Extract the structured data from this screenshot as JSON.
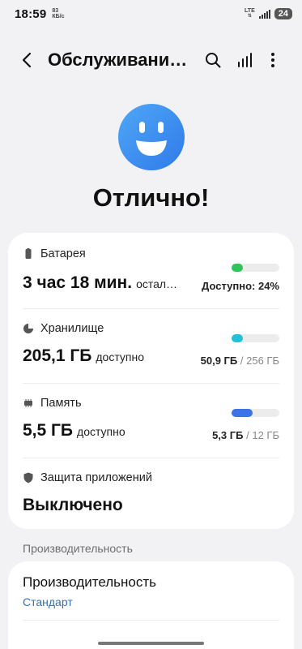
{
  "status_bar": {
    "time": "18:59",
    "net_speed_value": "83",
    "net_speed_unit": "КБ/с",
    "network_type": "LTE",
    "battery_level": "24"
  },
  "app_bar": {
    "title": "Обслуживани…"
  },
  "hero": {
    "status": "Отлично!",
    "icon": "smiley-face-icon",
    "accent_color": "#3b8df2"
  },
  "items": {
    "battery": {
      "label": "Батарея",
      "value": "3 час 18 мин.",
      "suffix": "остал…",
      "detail": "Доступно: 24%",
      "fill_fraction": 0.24,
      "color": "#2fc45a"
    },
    "storage": {
      "label": "Хранилище",
      "value": "205,1 ГБ",
      "suffix": "доступно",
      "used": "50,9 ГБ",
      "total": "/ 256 ГБ",
      "fill_fraction": 0.2,
      "color": "#1fc3d8"
    },
    "memory": {
      "label": "Память",
      "value": "5,5 ГБ",
      "suffix": "доступно",
      "used": "5,3 ГБ",
      "total": "/ 12 ГБ",
      "fill_fraction": 0.44,
      "color": "#3c74e8"
    },
    "app_protection": {
      "label": "Защита приложений",
      "value": "Выключено"
    }
  },
  "performance": {
    "section_header": "Производительность",
    "title": "Производительность",
    "mode": "Стандарт"
  }
}
